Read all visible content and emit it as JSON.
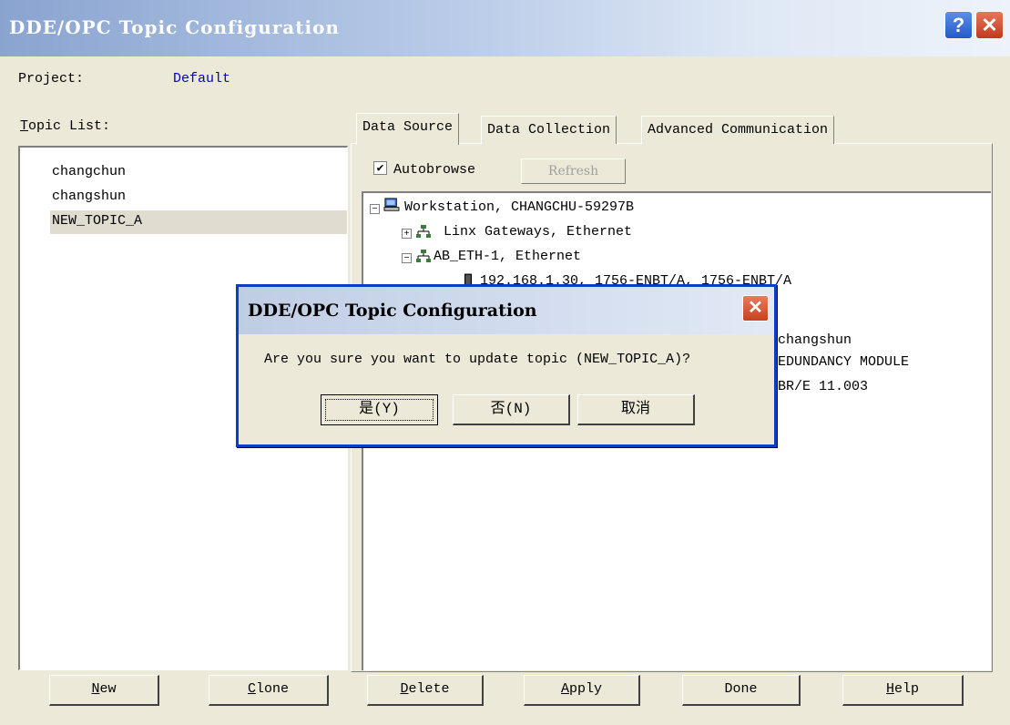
{
  "window": {
    "title": "DDE/OPC Topic Configuration"
  },
  "project": {
    "label": "Project:",
    "value": "Default"
  },
  "topic_list": {
    "label": "Topic List:",
    "items": [
      "changchun",
      "changshun",
      "NEW_TOPIC_A"
    ],
    "selected": "NEW_TOPIC_A"
  },
  "tabs": [
    "Data Source",
    "Data Collection",
    "Advanced Communication"
  ],
  "data_source": {
    "autobrowse_label": "Autobrowse",
    "autobrowse_checked": true,
    "refresh_label": "Refresh",
    "tree": [
      "Workstation, CHANGCHU-59297B",
      "Linx Gateways, Ethernet",
      "AB_ETH-1, Ethernet",
      "192.168.1.30, 1756-ENBT/A, 1756-ENBT/A"
    ],
    "partial_text": [
      "changshun",
      "EDUNDANCY MODULE",
      "BR/E 11.003"
    ]
  },
  "buttons": [
    "New",
    "Clone",
    "Delete",
    "Apply",
    "Done",
    "Help"
  ],
  "dialog": {
    "title": "DDE/OPC Topic Configuration",
    "message": "Are you sure you want to update topic (NEW_TOPIC_A)?",
    "yes_label": "是(Y)",
    "no_label": "否(N)",
    "cancel_label": "取消"
  },
  "icons": {
    "help": "question-mark-icon",
    "close": "close-icon",
    "workstation": "computer-icon",
    "network": "network-icon",
    "module": "module-icon"
  },
  "colors": {
    "title_bar": "#8aa4d0",
    "link_blue": "#0000cc",
    "dialog_border": "#0a3ec7",
    "close_red": "#c8401f"
  }
}
